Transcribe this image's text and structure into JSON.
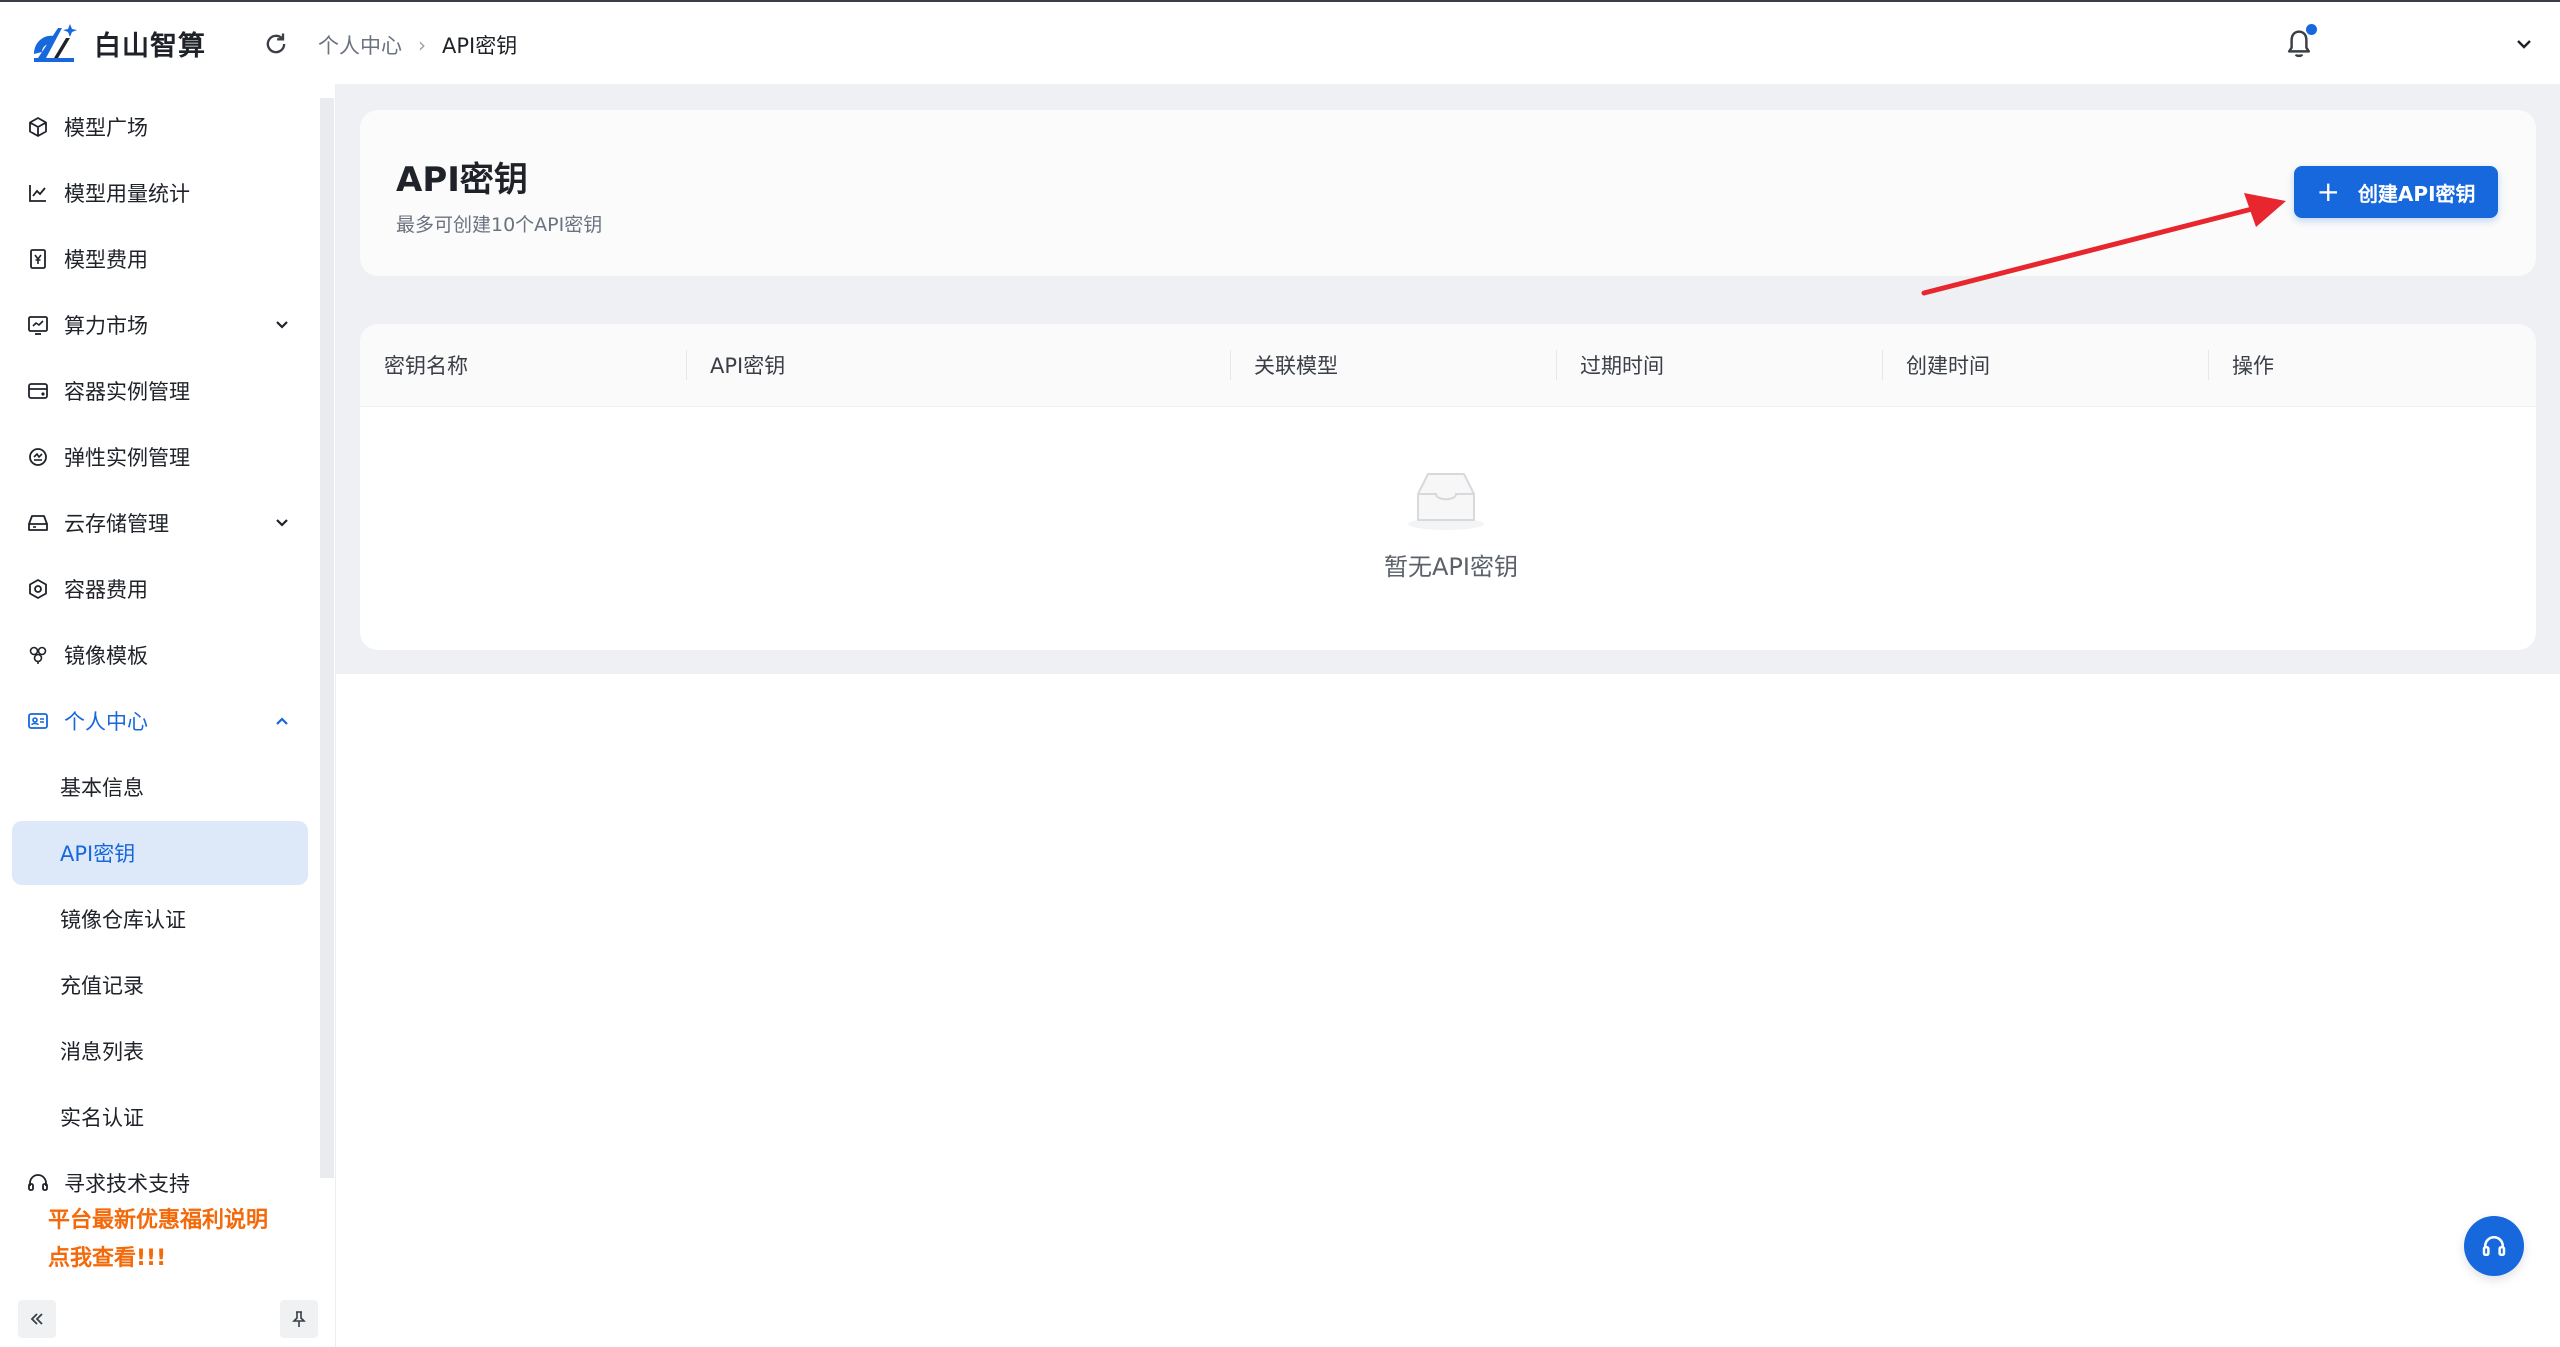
{
  "brand": {
    "name": "白山智算"
  },
  "breadcrumb": {
    "parent": "个人中心",
    "current": "API密钥"
  },
  "sidebar": {
    "items": [
      {
        "label": "模型广场"
      },
      {
        "label": "模型用量统计"
      },
      {
        "label": "模型费用"
      },
      {
        "label": "算力市场"
      },
      {
        "label": "容器实例管理"
      },
      {
        "label": "弹性实例管理"
      },
      {
        "label": "云存储管理"
      },
      {
        "label": "容器费用"
      },
      {
        "label": "镜像模板"
      },
      {
        "label": "个人中心"
      },
      {
        "label": "基本信息"
      },
      {
        "label": "API密钥"
      },
      {
        "label": "镜像仓库认证"
      },
      {
        "label": "充值记录"
      },
      {
        "label": "消息列表"
      },
      {
        "label": "实名认证"
      },
      {
        "label": "寻求技术支持"
      }
    ],
    "promo_line1": "平台最新优惠福利说明",
    "promo_line2": "点我查看!!!"
  },
  "page": {
    "title": "API密钥",
    "subtitle": "最多可创建10个API密钥",
    "create_button": "创建API密钥"
  },
  "table": {
    "columns": [
      "密钥名称",
      "API密钥",
      "关联模型",
      "过期时间",
      "创建时间",
      "操作"
    ],
    "empty_text": "暂无API密钥"
  },
  "colors": {
    "accent": "#1668dc",
    "promo": "#f46a0a",
    "active_bg": "#dde9f8",
    "annotation_arrow": "#e8262d"
  }
}
